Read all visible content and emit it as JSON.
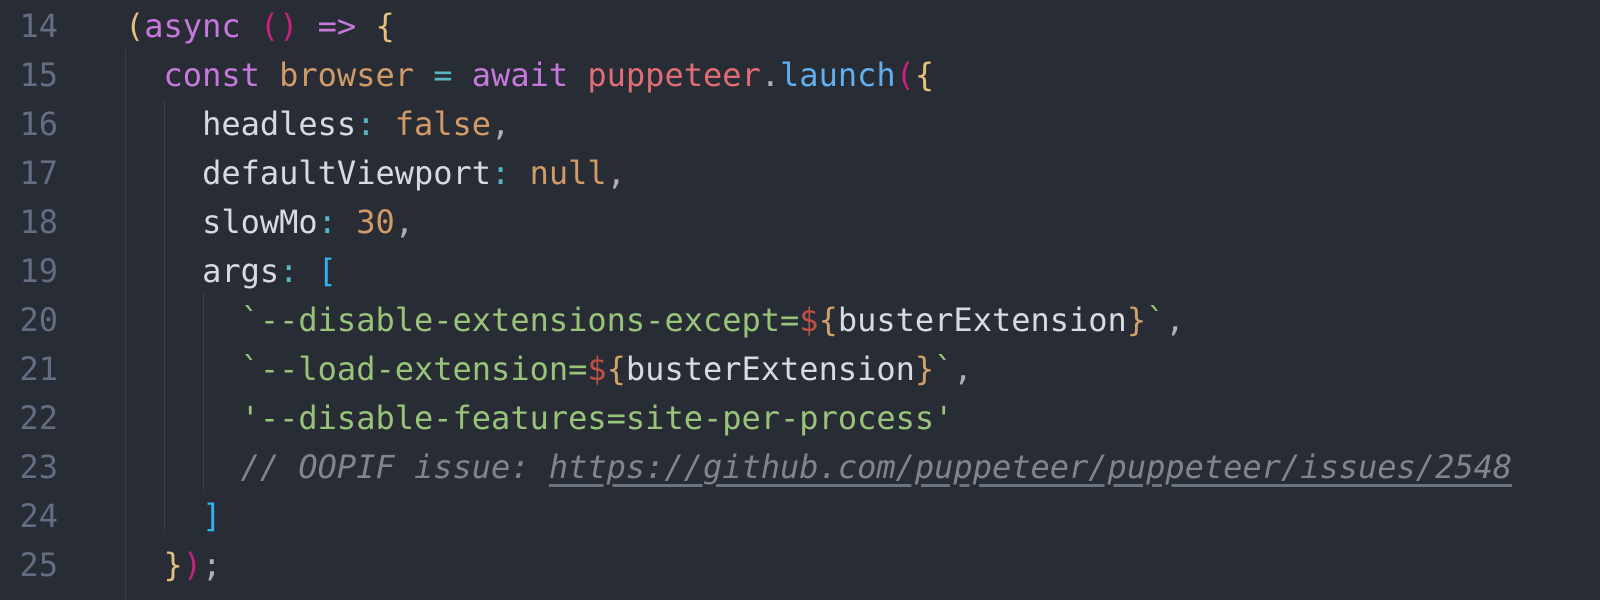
{
  "editor": {
    "lines": [
      {
        "number": "14",
        "tokens": [
          {
            "text": "(",
            "kind": "b1"
          },
          {
            "text": "async",
            "kind": "kw"
          },
          {
            "text": " ",
            "kind": "punc"
          },
          {
            "text": "()",
            "kind": "b2"
          },
          {
            "text": " ",
            "kind": "punc"
          },
          {
            "text": "=>",
            "kind": "kw"
          },
          {
            "text": " ",
            "kind": "punc"
          },
          {
            "text": "{",
            "kind": "b1"
          }
        ]
      },
      {
        "number": "15",
        "tokens": [
          {
            "text": "  ",
            "kind": "punc"
          },
          {
            "text": "const",
            "kind": "kw"
          },
          {
            "text": " ",
            "kind": "punc"
          },
          {
            "text": "browser",
            "kind": "num"
          },
          {
            "text": " ",
            "kind": "punc"
          },
          {
            "text": "=",
            "kind": "op"
          },
          {
            "text": " ",
            "kind": "punc"
          },
          {
            "text": "await",
            "kind": "kw"
          },
          {
            "text": " ",
            "kind": "punc"
          },
          {
            "text": "puppeteer",
            "kind": "var"
          },
          {
            "text": ".",
            "kind": "punc"
          },
          {
            "text": "launch",
            "kind": "fn"
          },
          {
            "text": "(",
            "kind": "b2"
          },
          {
            "text": "{",
            "kind": "b1"
          }
        ]
      },
      {
        "number": "16",
        "tokens": [
          {
            "text": "    ",
            "kind": "punc"
          },
          {
            "text": "headless",
            "kind": "prop"
          },
          {
            "text": ":",
            "kind": "op"
          },
          {
            "text": " ",
            "kind": "punc"
          },
          {
            "text": "false",
            "kind": "num"
          },
          {
            "text": ",",
            "kind": "punc"
          }
        ]
      },
      {
        "number": "17",
        "tokens": [
          {
            "text": "    ",
            "kind": "punc"
          },
          {
            "text": "defaultViewport",
            "kind": "prop"
          },
          {
            "text": ":",
            "kind": "op"
          },
          {
            "text": " ",
            "kind": "punc"
          },
          {
            "text": "null",
            "kind": "num"
          },
          {
            "text": ",",
            "kind": "punc"
          }
        ]
      },
      {
        "number": "18",
        "tokens": [
          {
            "text": "    ",
            "kind": "punc"
          },
          {
            "text": "slowMo",
            "kind": "prop"
          },
          {
            "text": ":",
            "kind": "op"
          },
          {
            "text": " ",
            "kind": "punc"
          },
          {
            "text": "30",
            "kind": "num"
          },
          {
            "text": ",",
            "kind": "punc"
          }
        ]
      },
      {
        "number": "19",
        "tokens": [
          {
            "text": "    ",
            "kind": "punc"
          },
          {
            "text": "args",
            "kind": "prop"
          },
          {
            "text": ":",
            "kind": "op"
          },
          {
            "text": " ",
            "kind": "punc"
          },
          {
            "text": "[",
            "kind": "b3"
          }
        ]
      },
      {
        "number": "20",
        "tokens": [
          {
            "text": "      ",
            "kind": "punc"
          },
          {
            "text": "`--disable-extensions-except=",
            "kind": "str"
          },
          {
            "text": "$",
            "kind": "interp"
          },
          {
            "text": "{",
            "kind": "tpl"
          },
          {
            "text": "busterExtension",
            "kind": "prop"
          },
          {
            "text": "}",
            "kind": "tpl"
          },
          {
            "text": "`",
            "kind": "str"
          },
          {
            "text": ",",
            "kind": "punc"
          }
        ]
      },
      {
        "number": "21",
        "tokens": [
          {
            "text": "      ",
            "kind": "punc"
          },
          {
            "text": "`--load-extension=",
            "kind": "str"
          },
          {
            "text": "$",
            "kind": "interp"
          },
          {
            "text": "{",
            "kind": "tpl"
          },
          {
            "text": "busterExtension",
            "kind": "prop"
          },
          {
            "text": "}",
            "kind": "tpl"
          },
          {
            "text": "`",
            "kind": "str"
          },
          {
            "text": ",",
            "kind": "punc"
          }
        ]
      },
      {
        "number": "22",
        "tokens": [
          {
            "text": "      ",
            "kind": "punc"
          },
          {
            "text": "'--disable-features=site-per-process'",
            "kind": "str"
          }
        ]
      },
      {
        "number": "23",
        "tokens": [
          {
            "text": "      ",
            "kind": "punc"
          },
          {
            "text": "// OOPIF issue: ",
            "kind": "cm"
          },
          {
            "text": "https://github.com/puppeteer/puppeteer/issues/2548",
            "kind": "cm",
            "link": true
          }
        ]
      },
      {
        "number": "24",
        "tokens": [
          {
            "text": "    ",
            "kind": "punc"
          },
          {
            "text": "]",
            "kind": "b3"
          }
        ]
      },
      {
        "number": "25",
        "tokens": [
          {
            "text": "  ",
            "kind": "punc"
          },
          {
            "text": "}",
            "kind": "b1"
          },
          {
            "text": ")",
            "kind": "b2"
          },
          {
            "text": ";",
            "kind": "punc"
          }
        ]
      }
    ]
  }
}
